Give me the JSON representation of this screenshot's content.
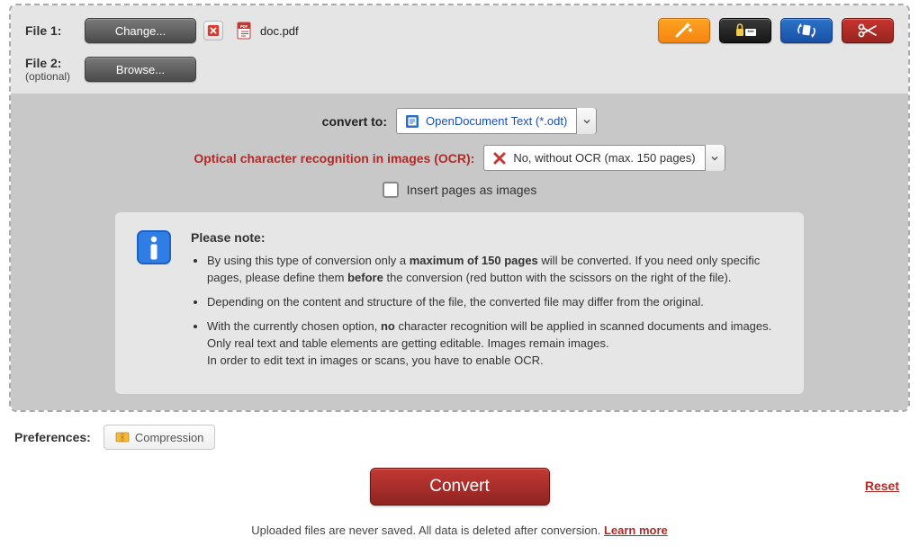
{
  "files": {
    "file1": {
      "label": "File 1:",
      "btn": "Change...",
      "filename": "doc.pdf"
    },
    "file2": {
      "label": "File 2:",
      "optional": "(optional)",
      "btn": "Browse..."
    }
  },
  "options": {
    "convert_to_label": "convert to:",
    "convert_to_value": "OpenDocument Text (*.odt)",
    "ocr_label": "Optical character recognition in images (OCR):",
    "ocr_value": "No, without OCR (max. 150 pages)",
    "insert_images_label": "Insert pages as images"
  },
  "note": {
    "title": "Please note:",
    "item1_a": "By using this type of conversion only a ",
    "item1_b": "maximum of 150 pages",
    "item1_c": " will be converted. If you need only specific pages, please define them ",
    "item1_d": "before",
    "item1_e": " the conversion (red button with the scissors on the right of the file).",
    "item2": "Depending on the content and structure of the file, the converted file may differ from the original.",
    "item3_a": "With the currently chosen option, ",
    "item3_b": "no",
    "item3_c": " character recognition will be applied in scanned documents and images. Only real text and table elements are getting editable. Images remain images.",
    "item3_d": "In order to edit text in images or scans, you have to enable OCR."
  },
  "prefs": {
    "label": "Preferences:",
    "compression": "Compression"
  },
  "buttons": {
    "convert": "Convert",
    "reset": "Reset"
  },
  "footer": {
    "text": "Uploaded files are never saved. All data is deleted after conversion. ",
    "learn_more": "Learn more"
  }
}
